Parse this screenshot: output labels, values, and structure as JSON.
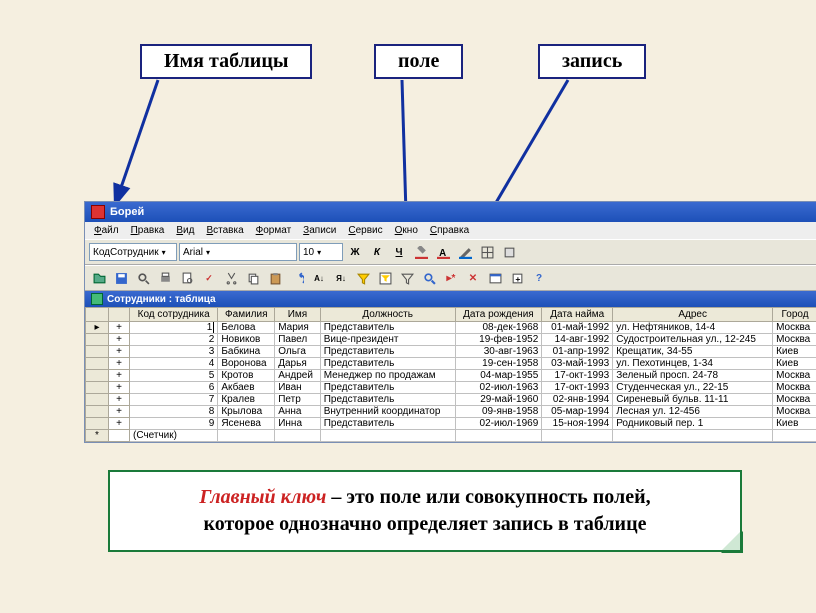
{
  "labels": {
    "tablename": "Имя таблицы",
    "field": "поле",
    "record": "запись"
  },
  "app": {
    "title": "Борей"
  },
  "menu": [
    "Файл",
    "Правка",
    "Вид",
    "Вставка",
    "Формат",
    "Записи",
    "Сервис",
    "Окно",
    "Справка"
  ],
  "toolbar1": {
    "field_combo": "КодСотрудник",
    "font_combo": "Arial",
    "size_combo": "10"
  },
  "subwindow_title": "Сотрудники : таблица",
  "columns": [
    "Код сотрудника",
    "Фамилия",
    "Имя",
    "Должность",
    "Дата рождения",
    "Дата найма",
    "Адрес",
    "Город"
  ],
  "rows": [
    {
      "id": "1",
      "fam": "Белова",
      "name": "Мария",
      "pos": "Представитель",
      "birth": "08-дек-1968",
      "hire": "01-май-1992",
      "addr": "ул. Нефтяников, 14-4",
      "city": "Москва"
    },
    {
      "id": "2",
      "fam": "Новиков",
      "name": "Павел",
      "pos": "Вице-президент",
      "birth": "19-фев-1952",
      "hire": "14-авг-1992",
      "addr": "Судостроительная ул., 12-245",
      "city": "Москва"
    },
    {
      "id": "3",
      "fam": "Бабкина",
      "name": "Ольга",
      "pos": "Представитель",
      "birth": "30-авг-1963",
      "hire": "01-апр-1992",
      "addr": "Крещатик, 34-55",
      "city": "Киев"
    },
    {
      "id": "4",
      "fam": "Воронова",
      "name": "Дарья",
      "pos": "Представитель",
      "birth": "19-сен-1958",
      "hire": "03-май-1993",
      "addr": "ул. Пехотинцев, 1-34",
      "city": "Киев"
    },
    {
      "id": "5",
      "fam": "Кротов",
      "name": "Андрей",
      "pos": "Менеджер по продажам",
      "birth": "04-мар-1955",
      "hire": "17-окт-1993",
      "addr": "Зеленый просп. 24-78",
      "city": "Москва"
    },
    {
      "id": "6",
      "fam": "Акбаев",
      "name": "Иван",
      "pos": "Представитель",
      "birth": "02-июл-1963",
      "hire": "17-окт-1993",
      "addr": "Студенческая ул., 22-15",
      "city": "Москва"
    },
    {
      "id": "7",
      "fam": "Кралев",
      "name": "Петр",
      "pos": "Представитель",
      "birth": "29-май-1960",
      "hire": "02-янв-1994",
      "addr": "Сиреневый бульв. 11-11",
      "city": "Москва"
    },
    {
      "id": "8",
      "fam": "Крылова",
      "name": "Анна",
      "pos": "Внутренний координатор",
      "birth": "09-янв-1958",
      "hire": "05-мар-1994",
      "addr": "Лесная ул. 12-456",
      "city": "Москва"
    },
    {
      "id": "9",
      "fam": "Ясенева",
      "name": "Инна",
      "pos": "Представитель",
      "birth": "02-июл-1969",
      "hire": "15-ноя-1994",
      "addr": "Родниковый пер. 1",
      "city": "Киев"
    }
  ],
  "counter_row": "(Счетчик)",
  "keytext": {
    "term": "Главный ключ",
    "dash": " – ",
    "rest1": "это поле или совокупность полей,",
    "rest2": "которое однозначно определяет запись в таблице"
  }
}
